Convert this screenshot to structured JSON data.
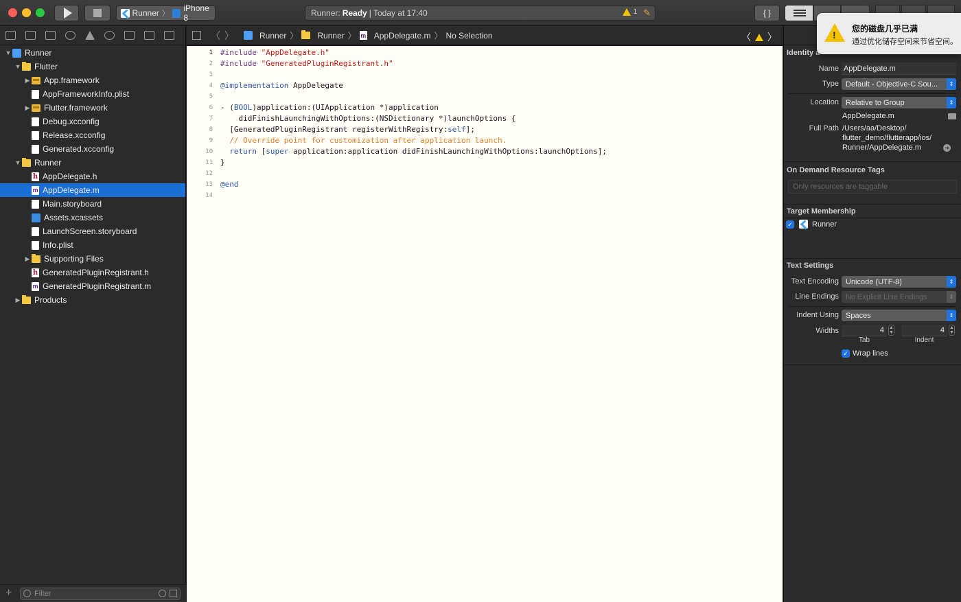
{
  "toolbar": {
    "scheme": "Runner",
    "device": "iPhone 8",
    "status_app": "Runner:",
    "status_state": "Ready",
    "status_time": "| Today at 17:40",
    "warning_count": "1"
  },
  "jumpbar": {
    "items": [
      "Runner",
      "Runner",
      "AppDelegate.m",
      "No Selection"
    ]
  },
  "navigator": {
    "tree": [
      {
        "label": "Runner",
        "icon": "project-icon",
        "indent": 0,
        "disclosure": "open"
      },
      {
        "label": "Flutter",
        "icon": "folder-icon",
        "indent": 1,
        "disclosure": "open"
      },
      {
        "label": "App.framework",
        "icon": "framework-icon",
        "indent": 2,
        "disclosure": "closed"
      },
      {
        "label": "AppFrameworkInfo.plist",
        "icon": "plist-icon",
        "indent": 2,
        "disclosure": "none"
      },
      {
        "label": "Flutter.framework",
        "icon": "framework-icon",
        "indent": 2,
        "disclosure": "closed"
      },
      {
        "label": "Debug.xcconfig",
        "icon": "xcconfig-icon",
        "indent": 2,
        "disclosure": "none"
      },
      {
        "label": "Release.xcconfig",
        "icon": "xcconfig-icon",
        "indent": 2,
        "disclosure": "none"
      },
      {
        "label": "Generated.xcconfig",
        "icon": "xcconfig-icon",
        "indent": 2,
        "disclosure": "none"
      },
      {
        "label": "Runner",
        "icon": "folder-icon",
        "indent": 1,
        "disclosure": "open"
      },
      {
        "label": "AppDelegate.h",
        "icon": "header-file-icon",
        "indent": 2,
        "disclosure": "none"
      },
      {
        "label": "AppDelegate.m",
        "icon": "objc-file-icon",
        "indent": 2,
        "disclosure": "none",
        "selected": true
      },
      {
        "label": "Main.storyboard",
        "icon": "storyboard-icon",
        "indent": 2,
        "disclosure": "none"
      },
      {
        "label": "Assets.xcassets",
        "icon": "assets-icon",
        "indent": 2,
        "disclosure": "none"
      },
      {
        "label": "LaunchScreen.storyboard",
        "icon": "storyboard-icon",
        "indent": 2,
        "disclosure": "none"
      },
      {
        "label": "Info.plist",
        "icon": "plist-icon",
        "indent": 2,
        "disclosure": "none"
      },
      {
        "label": "Supporting Files",
        "icon": "folder-icon",
        "indent": 2,
        "disclosure": "closed"
      },
      {
        "label": "GeneratedPluginRegistrant.h",
        "icon": "header-file-icon",
        "indent": 2,
        "disclosure": "none"
      },
      {
        "label": "GeneratedPluginRegistrant.m",
        "icon": "objc-file-icon",
        "indent": 2,
        "disclosure": "none"
      },
      {
        "label": "Products",
        "icon": "folder-icon",
        "indent": 1,
        "disclosure": "closed"
      }
    ],
    "filter_placeholder": "Filter"
  },
  "editor": {
    "current_line": 1,
    "lines": [
      [
        [
          "pp",
          "#include "
        ],
        [
          "str",
          "\"AppDelegate.h\""
        ]
      ],
      [
        [
          "pp",
          "#include "
        ],
        [
          "str",
          "\"GeneratedPluginRegistrant.h\""
        ]
      ],
      [],
      [
        [
          "kw",
          "@implementation"
        ],
        [
          "",
          " AppDelegate"
        ]
      ],
      [],
      [
        [
          "",
          "- ("
        ],
        [
          "kw",
          "BOOL"
        ],
        [
          "",
          ")application:(UIApplication *)application"
        ]
      ],
      [
        [
          "",
          "    didFinishLaunchingWithOptions:(NSDictionary *)launchOptions {"
        ]
      ],
      [
        [
          "",
          "  [GeneratedPluginRegistrant registerWithRegistry:"
        ],
        [
          "kw",
          "self"
        ],
        [
          "",
          "];"
        ]
      ],
      [
        [
          "cm",
          "  // Override point for customization after application launch."
        ]
      ],
      [
        [
          "kw",
          "  return"
        ],
        [
          "",
          " ["
        ],
        [
          "kw",
          "super"
        ],
        [
          "",
          " application:application didFinishLaunchingWithOptions:launchOptions];"
        ]
      ],
      [
        [
          "",
          "}"
        ]
      ],
      [],
      [
        [
          "kw",
          "@end"
        ]
      ],
      []
    ]
  },
  "inspector": {
    "identity_title": "Identity a",
    "name_label": "Name",
    "name_value": "AppDelegate.m",
    "type_label": "Type",
    "type_value": "Default - Objective-C Sou...",
    "location_label": "Location",
    "location_value": "Relative to Group",
    "location_file": "AppDelegate.m",
    "fullpath_label": "Full Path",
    "fullpath_line1": "/Users/aa/Desktop/",
    "fullpath_line2": "flutter_demo/flutterapp/ios/",
    "fullpath_line3": "Runner/AppDelegate.m",
    "odr_title": "On Demand Resource Tags",
    "odr_placeholder": "Only resources are taggable",
    "target_title": "Target Membership",
    "target_name": "Runner",
    "text_settings_title": "Text Settings",
    "encoding_label": "Text Encoding",
    "encoding_value": "Unicode (UTF-8)",
    "line_endings_label": "Line Endings",
    "line_endings_value": "No Explicit Line Endings",
    "indent_using_label": "Indent Using",
    "indent_using_value": "Spaces",
    "widths_label": "Widths",
    "tab_value": "4",
    "indent_value": "4",
    "tab_label": "Tab",
    "indent_label": "Indent",
    "wrap_label": "Wrap lines"
  },
  "notification": {
    "title": "您的磁盘几乎已满",
    "body": "通过优化储存空间来节省空间。"
  },
  "colors": {
    "selection": "#1b6ed3",
    "editor_bg": "#fffdf6",
    "string": "#c41a16",
    "keyword": "#2d5ba8",
    "comment": "#e0822b",
    "preprocessor": "#6b3c8a"
  }
}
